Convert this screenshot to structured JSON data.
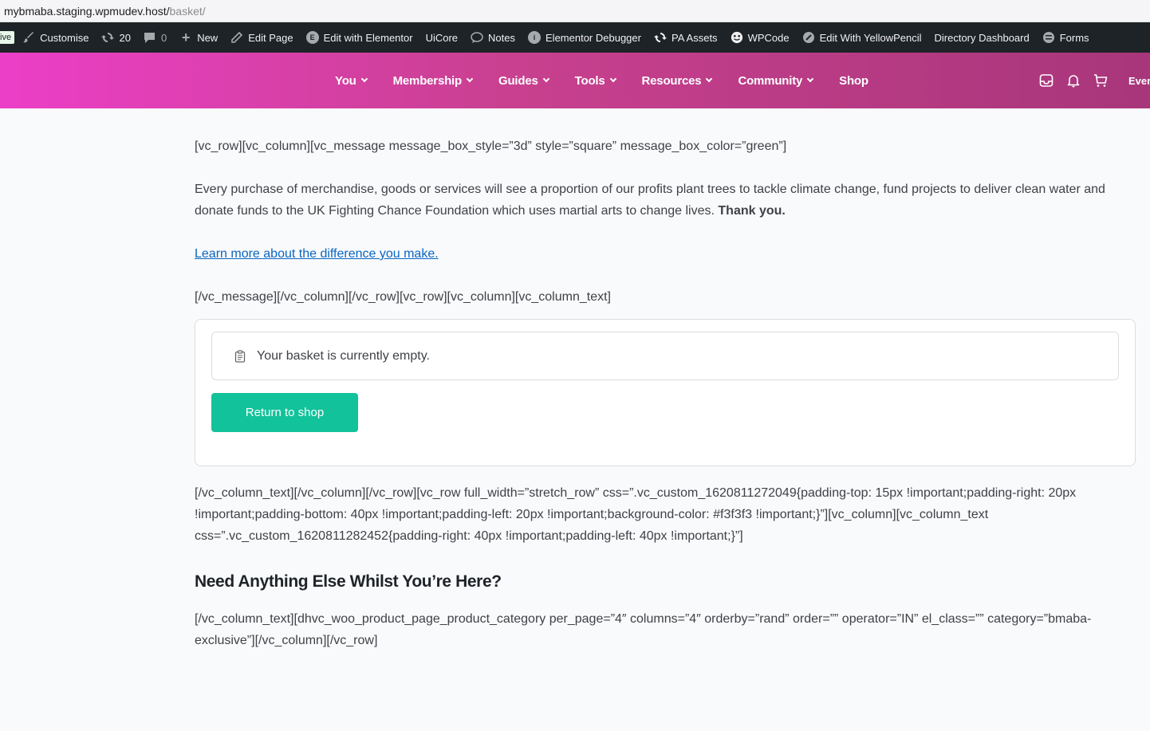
{
  "browser": {
    "url_host": "mybmaba.staging.wpmudev.host/",
    "url_path": "basket/"
  },
  "adminbar": {
    "live_label": "ive",
    "customise": "Customise",
    "updates_count": "20",
    "comments_count": "0",
    "new": "New",
    "edit_page": "Edit Page",
    "edit_elementor": "Edit with Elementor",
    "uicore": "UiCore",
    "notes": "Notes",
    "elementor_debugger": "Elementor Debugger",
    "pa_assets": "PA Assets",
    "wpcode": "WPCode",
    "yellowpencil": "Edit With YellowPencil",
    "directory_dashboard": "Directory Dashboard",
    "forms": "Forms"
  },
  "nav": {
    "items": [
      {
        "label": "You",
        "dropdown": true
      },
      {
        "label": "Membership",
        "dropdown": true
      },
      {
        "label": "Guides",
        "dropdown": true
      },
      {
        "label": "Tools",
        "dropdown": true
      },
      {
        "label": "Resources",
        "dropdown": true
      },
      {
        "label": "Community",
        "dropdown": true
      },
      {
        "label": "Shop",
        "dropdown": false
      }
    ],
    "events_partial": "Even",
    "gradient_colors": [
      "#ec3fc7",
      "#a8367a"
    ]
  },
  "content": {
    "shortcode_1": "[vc_row][vc_column][vc_message message_box_style=”3d” style=”square” message_box_color=”green”]",
    "intro_text": "Every purchase of merchandise, goods or services will see a proportion of our profits plant trees to tackle climate change, fund projects to deliver clean water and donate funds to the UK Fighting Chance Foundation which uses martial arts to change lives.",
    "intro_bold": "Thank you.",
    "learn_more": "Learn more about the difference you make.",
    "shortcode_2": "[/vc_message][/vc_column][/vc_row][vc_row][vc_column][vc_column_text]",
    "empty_notice": "Your basket is currently empty.",
    "return_button": "Return to shop",
    "shortcode_3": "[/vc_column_text][/vc_column][/vc_row][vc_row full_width=”stretch_row” css=”.vc_custom_1620811272049{padding-top: 15px !important;padding-right: 20px !important;padding-bottom: 40px !important;padding-left: 20px !important;background-color: #f3f3f3 !important;}”][vc_column][vc_column_text css=”.vc_custom_1620811282452{padding-right: 40px !important;padding-left: 40px !important;}”]",
    "heading": "Need Anything Else Whilst You’re Here?",
    "shortcode_4": "[/vc_column_text][dhvc_woo_product_page_product_category per_page=”4″ columns=”4″ orderby=”rand” order=”” operator=”IN” el_class=”” category=”bmaba-exclusive”][/vc_column][/vc_row]"
  },
  "colors": {
    "button": "#12c29a",
    "link": "#0a66c2"
  }
}
